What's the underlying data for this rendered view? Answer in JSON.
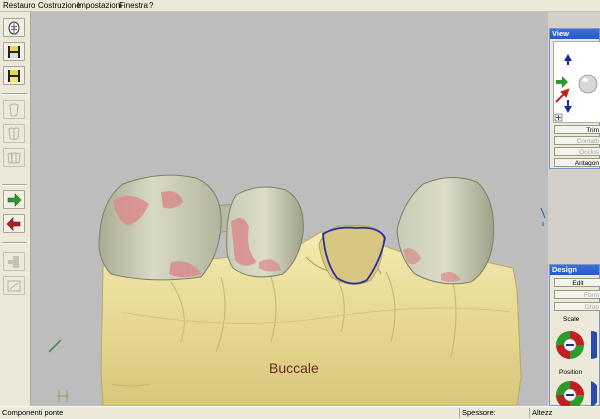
{
  "menu": [
    "Restauro",
    "Costruzione",
    "Impostazioni",
    "Finestra",
    "?"
  ],
  "viewport": {
    "side_label": "Buccale"
  },
  "view_panel": {
    "title": "View",
    "buttons": [
      "Trim",
      "Contatti",
      "Occlus",
      "Antagon"
    ]
  },
  "design_panel": {
    "title": "Design",
    "buttons": [
      "Edit",
      "Form",
      "Drop"
    ],
    "scale_label": "Scale",
    "position_label": "Position"
  },
  "status": {
    "left": "Componenti ponte",
    "spessore": "Spessore:",
    "altezza": "Altezz"
  },
  "colors": {
    "stone": "#e8dc98",
    "tooth": "#cdcfb3",
    "contact": "#d98b8c",
    "margin_line": "#2a32a0",
    "viewport_bg": "#bdbdbd"
  },
  "icons": [
    "jaw-icon",
    "save-icon",
    "save-as-icon",
    "tooth-single-icon",
    "tooth-double-icon",
    "tooth-triple-icon",
    "arrow-right-icon",
    "arrow-left-icon",
    "connector-icon",
    "scan-icon"
  ]
}
